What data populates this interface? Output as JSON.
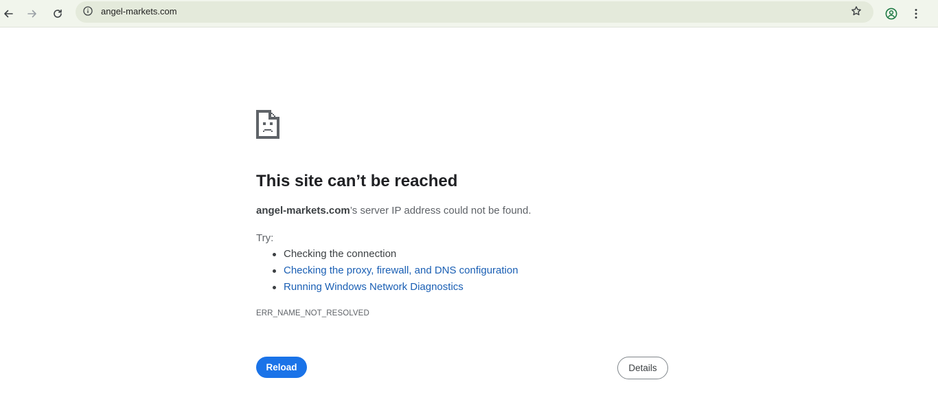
{
  "browser": {
    "url": "angel-markets.com",
    "icons": {
      "back": "arrow-left-icon",
      "forward": "arrow-right-icon",
      "reload": "refresh-icon",
      "site_info": "info-circle-icon",
      "bookmark": "star-outline-icon",
      "profile": "account-circle-icon",
      "menu": "kebab-menu-icon"
    }
  },
  "error": {
    "icon": "sad-document-icon",
    "title": "This site can’t be reached",
    "host": "angel-markets.com",
    "message": "’s server IP address could not be found.",
    "try_label": "Try:",
    "suggestions": [
      {
        "text": "Checking the connection",
        "link": false
      },
      {
        "text": "Checking the proxy, firewall, and DNS configuration",
        "link": true
      },
      {
        "text": "Running Windows Network Diagnostics",
        "link": true
      }
    ],
    "code": "ERR_NAME_NOT_RESOLVED",
    "reload_label": "Reload",
    "details_label": "Details"
  },
  "colors": {
    "toolbar_bg": "#f1f5ec",
    "omnibox_bg": "#e4eadb",
    "primary_button": "#1a73e8",
    "link": "#1a5fb4",
    "title_text": "#202124",
    "body_text": "#5f6368"
  }
}
